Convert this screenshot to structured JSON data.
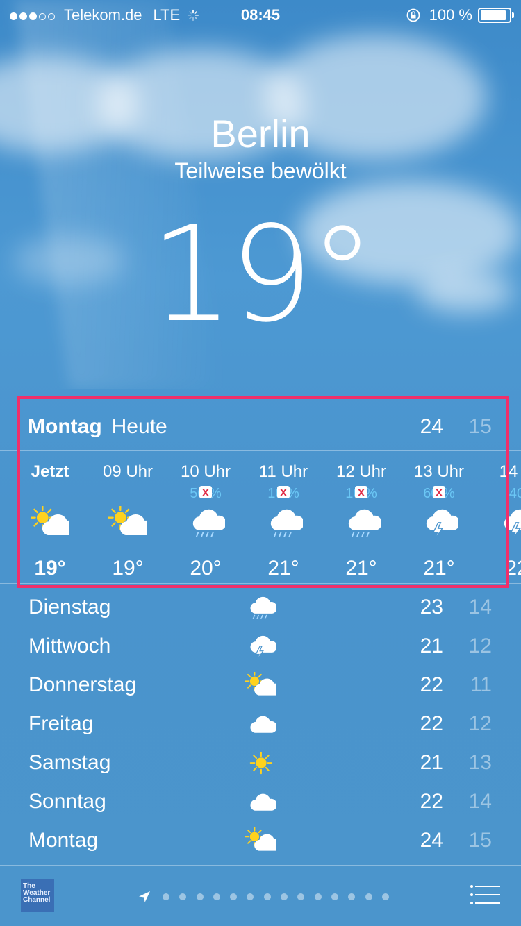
{
  "status_bar": {
    "carrier": "Telekom.de",
    "network": "LTE",
    "time": "08:45",
    "battery": "100 %",
    "battery_level": 1.0
  },
  "header": {
    "city": "Berlin",
    "condition": "Teilweise bewölkt",
    "temperature": "19°"
  },
  "today": {
    "day": "Montag",
    "label": "Heute",
    "high": "24",
    "low": "15"
  },
  "hourly": [
    {
      "time": "Jetzt",
      "precip": "",
      "icon": "partly-sunny-icon",
      "temp": "19°"
    },
    {
      "time": "09 Uhr",
      "precip": "",
      "icon": "partly-sunny-icon",
      "temp": "19°"
    },
    {
      "time": "10 Uhr",
      "precip": "50 %",
      "icon": "rain-cloud-icon",
      "temp": "20°"
    },
    {
      "time": "11 Uhr",
      "precip": "10 %",
      "icon": "rain-cloud-icon",
      "temp": "21°"
    },
    {
      "time": "12 Uhr",
      "precip": "10 %",
      "icon": "rain-cloud-icon",
      "temp": "21°"
    },
    {
      "time": "13 Uhr",
      "precip": "60 %",
      "icon": "thunder-cloud-icon",
      "temp": "21°"
    },
    {
      "time": "14 U",
      "precip": "40",
      "icon": "thunder-cloud-icon",
      "temp": "22"
    }
  ],
  "daily": [
    {
      "day": "Dienstag",
      "icon": "rain-cloud-icon",
      "high": "23",
      "low": "14"
    },
    {
      "day": "Mittwoch",
      "icon": "thunder-cloud-icon",
      "high": "21",
      "low": "12"
    },
    {
      "day": "Donnerstag",
      "icon": "partly-sunny-icon",
      "high": "22",
      "low": "11"
    },
    {
      "day": "Freitag",
      "icon": "cloud-icon",
      "high": "22",
      "low": "12"
    },
    {
      "day": "Samstag",
      "icon": "sun-icon",
      "high": "21",
      "low": "13"
    },
    {
      "day": "Sonntag",
      "icon": "cloud-icon",
      "high": "22",
      "low": "14"
    },
    {
      "day": "Montag",
      "icon": "partly-sunny-icon",
      "high": "24",
      "low": "15"
    }
  ],
  "footer": {
    "logo_text": "The Weather Channel",
    "page_count": 14,
    "current_page": 0
  },
  "colors": {
    "highlight": "#f0306a",
    "precip": "#6bc7f5",
    "sun": "#ffd21e"
  }
}
